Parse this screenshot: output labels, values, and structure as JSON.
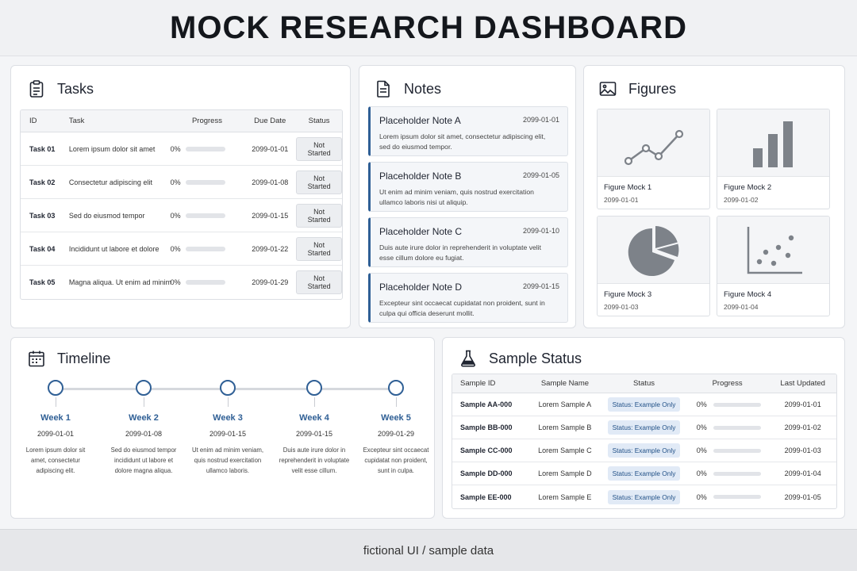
{
  "header": {
    "title": "MOCK RESEARCH DASHBOARD"
  },
  "tasks": {
    "title": "Tasks",
    "columns": [
      "ID",
      "Task",
      "Progress",
      "Due Date",
      "Status"
    ],
    "rows": [
      {
        "id": "Task 01",
        "task": "Lorem ipsum dolor sit amet",
        "progress": "0%",
        "progress_value": 0,
        "due": "2099-01-01",
        "status": "Not Started"
      },
      {
        "id": "Task 02",
        "task": "Consectetur adipiscing elit",
        "progress": "0%",
        "progress_value": 0,
        "due": "2099-01-08",
        "status": "Not Started"
      },
      {
        "id": "Task 03",
        "task": "Sed do eiusmod tempor",
        "progress": "0%",
        "progress_value": 0,
        "due": "2099-01-15",
        "status": "Not Started"
      },
      {
        "id": "Task 04",
        "task": "Incididunt ut labore et dolore",
        "progress": "0%",
        "progress_value": 0,
        "due": "2099-01-22",
        "status": "Not Started"
      },
      {
        "id": "Task 05",
        "task": "Magna aliqua. Ut enim ad minim",
        "progress": "0%",
        "progress_value": 0,
        "due": "2099-01-29",
        "status": "Not Started"
      }
    ]
  },
  "notes": {
    "title": "Notes",
    "items": [
      {
        "title": "Placeholder Note A",
        "date": "2099-01-01",
        "body": "Lorem ipsum dolor sit amet, consectetur adipiscing elit, sed do eiusmod tempor."
      },
      {
        "title": "Placeholder Note B",
        "date": "2099-01-05",
        "body": "Ut enim ad minim veniam, quis nostrud exercitation ullamco laboris nisi ut aliquip."
      },
      {
        "title": "Placeholder Note C",
        "date": "2099-01-10",
        "body": "Duis aute irure dolor in reprehenderit in voluptate velit esse cillum dolore eu fugiat."
      },
      {
        "title": "Placeholder Note D",
        "date": "2099-01-15",
        "body": "Excepteur sint occaecat cupidatat non proident, sunt in culpa qui officia deserunt mollit."
      }
    ]
  },
  "figures": {
    "title": "Figures",
    "items": [
      {
        "name": "Figure Mock 1",
        "date": "2099-01-01",
        "icon": "line-chart-icon"
      },
      {
        "name": "Figure Mock 2",
        "date": "2099-01-02",
        "icon": "bar-chart-icon"
      },
      {
        "name": "Figure Mock 3",
        "date": "2099-01-03",
        "icon": "pie-chart-icon"
      },
      {
        "name": "Figure Mock 4",
        "date": "2099-01-04",
        "icon": "scatter-plot-icon"
      }
    ]
  },
  "timeline": {
    "title": "Timeline",
    "items": [
      {
        "week": "Week 1",
        "date": "2099-01-01",
        "text": "Lorem ipsum dolor sit amet, consectetur adipiscing elit."
      },
      {
        "week": "Week 2",
        "date": "2099-01-08",
        "text": "Sed do eiusmod tempor incididunt ut labore et dolore magna aliqua."
      },
      {
        "week": "Week 3",
        "date": "2099-01-15",
        "text": "Ut enim ad minim veniam, quis nostrud exercitation ullamco laboris."
      },
      {
        "week": "Week 4",
        "date": "2099-01-15",
        "text": "Duis aute irure dolor in reprehenderit in voluptate velit esse cillum."
      },
      {
        "week": "Week 5",
        "date": "2099-01-29",
        "text": "Excepteur sint occaecat cupidatat non proident, sunt in culpa."
      }
    ]
  },
  "samples": {
    "title": "Sample Status",
    "columns": [
      "Sample ID",
      "Sample Name",
      "Status",
      "Progress",
      "Last Updated"
    ],
    "rows": [
      {
        "id": "Sample AA-000",
        "name": "Lorem Sample A",
        "status": "Status: Example Only",
        "progress": "0%",
        "progress_value": 0,
        "updated": "2099-01-01"
      },
      {
        "id": "Sample BB-000",
        "name": "Lorem Sample B",
        "status": "Status: Example Only",
        "progress": "0%",
        "progress_value": 0,
        "updated": "2099-01-02"
      },
      {
        "id": "Sample CC-000",
        "name": "Lorem Sample C",
        "status": "Status: Example Only",
        "progress": "0%",
        "progress_value": 0,
        "updated": "2099-01-03"
      },
      {
        "id": "Sample DD-000",
        "name": "Lorem Sample D",
        "status": "Status: Example Only",
        "progress": "0%",
        "progress_value": 0,
        "updated": "2099-01-04"
      },
      {
        "id": "Sample EE-000",
        "name": "Lorem Sample E",
        "status": "Status: Example Only",
        "progress": "0%",
        "progress_value": 0,
        "updated": "2099-01-05"
      }
    ]
  },
  "footer": {
    "text": "fictional UI / sample data"
  },
  "colors": {
    "accent": "#2f5f95",
    "icon": "#7d8289",
    "panel_border": "#dcdfe4"
  }
}
